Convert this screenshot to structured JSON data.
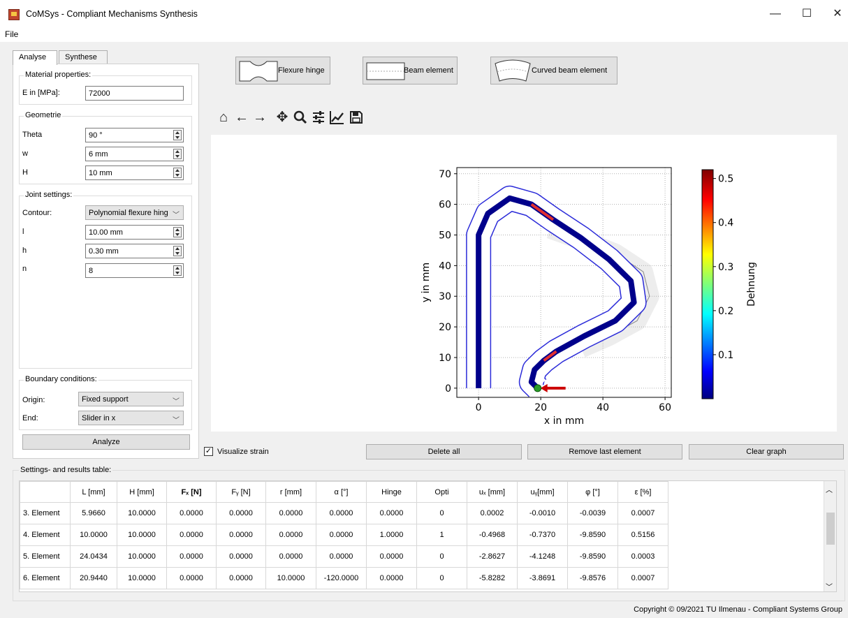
{
  "window": {
    "title": "CoMSys - Compliant Mechanisms Synthesis",
    "minimize": "—",
    "maximize": "☐",
    "close": "✕"
  },
  "menu": {
    "file": "File"
  },
  "tabs": [
    "Analyse",
    "Synthese"
  ],
  "material": {
    "title": "Material properties:",
    "e_label": "E in [MPa]:",
    "e_value": "72000"
  },
  "geometry": {
    "title": "Geometrie",
    "theta_label": "Theta",
    "theta_value": "90 °",
    "w_label": "w",
    "w_value": "6 mm",
    "h_label": "H",
    "h_value": "10 mm"
  },
  "joint": {
    "title": "Joint settings:",
    "contour_label": "Contour:",
    "contour_value": "Polynomial flexure hing",
    "l_label": "l",
    "l_value": "10.00 mm",
    "h_label": "h",
    "h_value": "0.30 mm",
    "n_label": "n",
    "n_value": "8"
  },
  "boundary": {
    "title": "Boundary conditions:",
    "origin_label": "Origin:",
    "origin_value": "Fixed support",
    "end_label": "End:",
    "end_value": "Slider in x"
  },
  "analyze_button": "Analyze",
  "elements": {
    "flexure": "Flexure hinge",
    "beam": "Beam element",
    "curved": "Curved beam element"
  },
  "toolbar_icons": [
    "home-icon",
    "back-icon",
    "forward-icon",
    "pan-icon",
    "zoom-icon",
    "configure-icon",
    "edit-axes-icon",
    "save-icon"
  ],
  "chart_data": {
    "type": "line",
    "xlabel": "x in mm",
    "ylabel": "y in mm",
    "xlim": [
      -7,
      62
    ],
    "ylim": [
      -3,
      72
    ],
    "xticks": [
      0,
      20,
      40,
      60
    ],
    "yticks": [
      0,
      10,
      20,
      30,
      40,
      50,
      60,
      70
    ],
    "grid": true,
    "colorbar": {
      "label": "Dehnung",
      "ticks": [
        0.1,
        0.2,
        0.3,
        0.4,
        0.5
      ],
      "range": [
        0.0,
        0.52
      ]
    },
    "centerline": [
      [
        0,
        0
      ],
      [
        0,
        50
      ],
      [
        3,
        57
      ],
      [
        10,
        62
      ],
      [
        17,
        60
      ],
      [
        24,
        55
      ],
      [
        33,
        49
      ],
      [
        42,
        42
      ],
      [
        49,
        35
      ],
      [
        50,
        28
      ],
      [
        44,
        22
      ],
      [
        34,
        17
      ],
      [
        25,
        12
      ],
      [
        21,
        9
      ],
      [
        18,
        6
      ],
      [
        17,
        2
      ],
      [
        19,
        0
      ]
    ],
    "deformed_centerline": [
      [
        23,
        52
      ],
      [
        34,
        48
      ],
      [
        44,
        44
      ],
      [
        53,
        38
      ],
      [
        55,
        30
      ],
      [
        51,
        22
      ],
      [
        42,
        17
      ],
      [
        33,
        13
      ]
    ],
    "force_marker": {
      "x": 19,
      "y": 0
    }
  },
  "checkbox": {
    "label": "Visualize strain",
    "checked": true
  },
  "actions": {
    "delete_all": "Delete all",
    "remove_last": "Remove last element",
    "clear_graph": "Clear graph"
  },
  "results": {
    "title": "Settings- and results table:",
    "headers": [
      "L [mm]",
      "H [mm]",
      "Fₓ [N]",
      "Fᵧ [N]",
      "r [mm]",
      "α [°]",
      "Hinge",
      "Opti",
      "uₓ [mm]",
      "uᵧ[mm]",
      "φ  [°]",
      "ε [%]"
    ],
    "rows": [
      {
        "label": "3. Element",
        "cells": [
          "5.9660",
          "10.0000",
          "0.0000",
          "0.0000",
          "0.0000",
          "0.0000",
          "0.0000",
          "0",
          "0.0002",
          "-0.0010",
          "-0.0039",
          "0.0007"
        ]
      },
      {
        "label": "4. Element",
        "cells": [
          "10.0000",
          "10.0000",
          "0.0000",
          "0.0000",
          "0.0000",
          "0.0000",
          "1.0000",
          "1",
          "-0.4968",
          "-0.7370",
          "-9.8590",
          "0.5156"
        ]
      },
      {
        "label": "5. Element",
        "cells": [
          "24.0434",
          "10.0000",
          "0.0000",
          "0.0000",
          "0.0000",
          "0.0000",
          "0.0000",
          "0",
          "-2.8627",
          "-4.1248",
          "-9.8590",
          "0.0003"
        ]
      },
      {
        "label": "6. Element",
        "cells": [
          "20.9440",
          "10.0000",
          "0.0000",
          "0.0000",
          "10.0000",
          "-120.0000",
          "0.0000",
          "0",
          "-5.8282",
          "-3.8691",
          "-9.8576",
          "0.0007"
        ]
      }
    ]
  },
  "footer": "Copyright © 09/2021 TU Ilmenau - Compliant Systems Group"
}
